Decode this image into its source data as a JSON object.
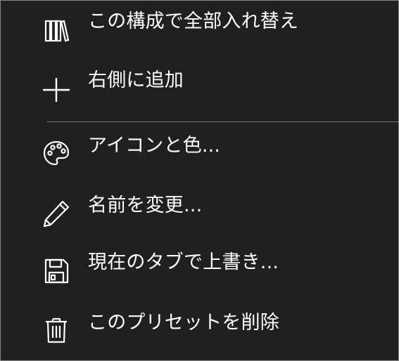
{
  "menu": {
    "items": [
      {
        "label": "この構成で全部入れ替え",
        "icon": "library-icon"
      },
      {
        "label": "右側に追加",
        "icon": "plus-icon"
      },
      {
        "label": "アイコンと色...",
        "icon": "palette-icon"
      },
      {
        "label": "名前を変更...",
        "icon": "pencil-icon"
      },
      {
        "label": "現在のタブで上書き...",
        "icon": "save-icon"
      },
      {
        "label": "このプリセットを削除",
        "icon": "trash-icon"
      }
    ]
  },
  "colors": {
    "background": "#202020",
    "text": "#ffffff",
    "border": "#8a8a8a",
    "separator": "#7a7a7a"
  }
}
